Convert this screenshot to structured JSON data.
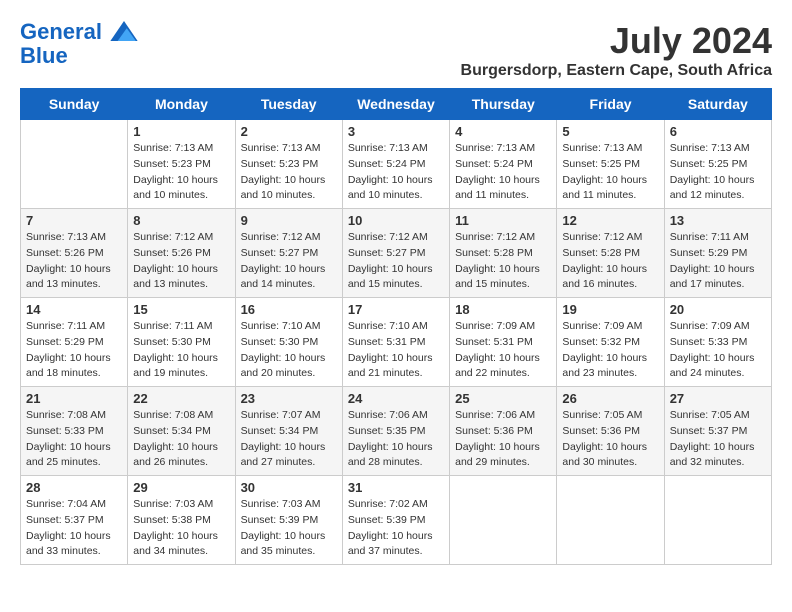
{
  "header": {
    "logo_line1": "General",
    "logo_line2": "Blue",
    "main_title": "July 2024",
    "subtitle": "Burgersdorp, Eastern Cape, South Africa"
  },
  "days_of_week": [
    "Sunday",
    "Monday",
    "Tuesday",
    "Wednesday",
    "Thursday",
    "Friday",
    "Saturday"
  ],
  "weeks": [
    [
      {
        "day": "",
        "info": ""
      },
      {
        "day": "1",
        "info": "Sunrise: 7:13 AM\nSunset: 5:23 PM\nDaylight: 10 hours\nand 10 minutes."
      },
      {
        "day": "2",
        "info": "Sunrise: 7:13 AM\nSunset: 5:23 PM\nDaylight: 10 hours\nand 10 minutes."
      },
      {
        "day": "3",
        "info": "Sunrise: 7:13 AM\nSunset: 5:24 PM\nDaylight: 10 hours\nand 10 minutes."
      },
      {
        "day": "4",
        "info": "Sunrise: 7:13 AM\nSunset: 5:24 PM\nDaylight: 10 hours\nand 11 minutes."
      },
      {
        "day": "5",
        "info": "Sunrise: 7:13 AM\nSunset: 5:25 PM\nDaylight: 10 hours\nand 11 minutes."
      },
      {
        "day": "6",
        "info": "Sunrise: 7:13 AM\nSunset: 5:25 PM\nDaylight: 10 hours\nand 12 minutes."
      }
    ],
    [
      {
        "day": "7",
        "info": "Sunrise: 7:13 AM\nSunset: 5:26 PM\nDaylight: 10 hours\nand 13 minutes."
      },
      {
        "day": "8",
        "info": "Sunrise: 7:12 AM\nSunset: 5:26 PM\nDaylight: 10 hours\nand 13 minutes."
      },
      {
        "day": "9",
        "info": "Sunrise: 7:12 AM\nSunset: 5:27 PM\nDaylight: 10 hours\nand 14 minutes."
      },
      {
        "day": "10",
        "info": "Sunrise: 7:12 AM\nSunset: 5:27 PM\nDaylight: 10 hours\nand 15 minutes."
      },
      {
        "day": "11",
        "info": "Sunrise: 7:12 AM\nSunset: 5:28 PM\nDaylight: 10 hours\nand 15 minutes."
      },
      {
        "day": "12",
        "info": "Sunrise: 7:12 AM\nSunset: 5:28 PM\nDaylight: 10 hours\nand 16 minutes."
      },
      {
        "day": "13",
        "info": "Sunrise: 7:11 AM\nSunset: 5:29 PM\nDaylight: 10 hours\nand 17 minutes."
      }
    ],
    [
      {
        "day": "14",
        "info": "Sunrise: 7:11 AM\nSunset: 5:29 PM\nDaylight: 10 hours\nand 18 minutes."
      },
      {
        "day": "15",
        "info": "Sunrise: 7:11 AM\nSunset: 5:30 PM\nDaylight: 10 hours\nand 19 minutes."
      },
      {
        "day": "16",
        "info": "Sunrise: 7:10 AM\nSunset: 5:30 PM\nDaylight: 10 hours\nand 20 minutes."
      },
      {
        "day": "17",
        "info": "Sunrise: 7:10 AM\nSunset: 5:31 PM\nDaylight: 10 hours\nand 21 minutes."
      },
      {
        "day": "18",
        "info": "Sunrise: 7:09 AM\nSunset: 5:31 PM\nDaylight: 10 hours\nand 22 minutes."
      },
      {
        "day": "19",
        "info": "Sunrise: 7:09 AM\nSunset: 5:32 PM\nDaylight: 10 hours\nand 23 minutes."
      },
      {
        "day": "20",
        "info": "Sunrise: 7:09 AM\nSunset: 5:33 PM\nDaylight: 10 hours\nand 24 minutes."
      }
    ],
    [
      {
        "day": "21",
        "info": "Sunrise: 7:08 AM\nSunset: 5:33 PM\nDaylight: 10 hours\nand 25 minutes."
      },
      {
        "day": "22",
        "info": "Sunrise: 7:08 AM\nSunset: 5:34 PM\nDaylight: 10 hours\nand 26 minutes."
      },
      {
        "day": "23",
        "info": "Sunrise: 7:07 AM\nSunset: 5:34 PM\nDaylight: 10 hours\nand 27 minutes."
      },
      {
        "day": "24",
        "info": "Sunrise: 7:06 AM\nSunset: 5:35 PM\nDaylight: 10 hours\nand 28 minutes."
      },
      {
        "day": "25",
        "info": "Sunrise: 7:06 AM\nSunset: 5:36 PM\nDaylight: 10 hours\nand 29 minutes."
      },
      {
        "day": "26",
        "info": "Sunrise: 7:05 AM\nSunset: 5:36 PM\nDaylight: 10 hours\nand 30 minutes."
      },
      {
        "day": "27",
        "info": "Sunrise: 7:05 AM\nSunset: 5:37 PM\nDaylight: 10 hours\nand 32 minutes."
      }
    ],
    [
      {
        "day": "28",
        "info": "Sunrise: 7:04 AM\nSunset: 5:37 PM\nDaylight: 10 hours\nand 33 minutes."
      },
      {
        "day": "29",
        "info": "Sunrise: 7:03 AM\nSunset: 5:38 PM\nDaylight: 10 hours\nand 34 minutes."
      },
      {
        "day": "30",
        "info": "Sunrise: 7:03 AM\nSunset: 5:39 PM\nDaylight: 10 hours\nand 35 minutes."
      },
      {
        "day": "31",
        "info": "Sunrise: 7:02 AM\nSunset: 5:39 PM\nDaylight: 10 hours\nand 37 minutes."
      },
      {
        "day": "",
        "info": ""
      },
      {
        "day": "",
        "info": ""
      },
      {
        "day": "",
        "info": ""
      }
    ]
  ]
}
